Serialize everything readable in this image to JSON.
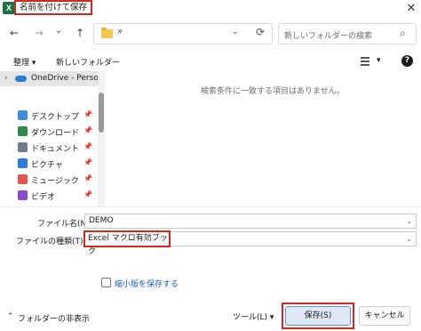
{
  "window": {
    "app_icon_letter": "X",
    "title": "名前を付けて保存",
    "close_glyph": "✕"
  },
  "address_bar": {
    "back_glyph": "←",
    "forward_glyph": "→",
    "history_glyph": "⌄",
    "up_glyph": "↑",
    "path_text": "»",
    "dropdown_glyph": "⌄",
    "refresh_glyph": "⟳"
  },
  "search": {
    "placeholder": "新しいフォルダーの検索",
    "icon": "search-icon",
    "icon_glyph": "⌕"
  },
  "toolbar": {
    "organize_label": "整理 ▾",
    "new_folder_label": "新しいフォルダー",
    "view_dropdown_glyph": "▾",
    "help_glyph": "?"
  },
  "nav_pane": {
    "items": [
      {
        "label": "OneDrive - Persor",
        "icon": "cloud-icon",
        "icon_color": "#2b7cd3",
        "pinned": false
      },
      {
        "label": "デスクトップ",
        "icon": "desktop-icon",
        "icon_color": "#3b8fd9",
        "pinned": true
      },
      {
        "label": "ダウンロード",
        "icon": "download-icon",
        "icon_color": "#2f8a4e",
        "pinned": true
      },
      {
        "label": "ドキュメント",
        "icon": "documents-icon",
        "icon_color": "#6f7b8a",
        "pinned": true
      },
      {
        "label": "ピクチャ",
        "icon": "pictures-icon",
        "icon_color": "#2f7ad9",
        "pinned": true
      },
      {
        "label": "ミュージック",
        "icon": "music-icon",
        "icon_color": "#e2554f",
        "pinned": true
      },
      {
        "label": "ビデオ",
        "icon": "videos-icon",
        "icon_color": "#8a4bd1",
        "pinned": true
      }
    ],
    "pin_glyph": "📌",
    "expand_glyph": "›"
  },
  "content": {
    "empty_message": "検索条件に一致する項目はありません。"
  },
  "form": {
    "filename_label": "ファイル名(N):",
    "filename_value": "DEMO",
    "filetype_label": "ファイルの種類(T):",
    "filetype_value": "Excel マクロ有効ブック",
    "dropdown_glyph": "⌄",
    "thumbnail_label": "縮小版を保存する"
  },
  "footer": {
    "hide_folders_label": "フォルダーの非表示",
    "hide_folders_glyph": "⌃",
    "tools_label": "ツール(L) ▾",
    "save_label": "保存(S)",
    "cancel_label": "キャンセル"
  },
  "colors": {
    "highlight_red": "#d7261e",
    "link_blue": "#1a5fb4",
    "excel_green": "#1d7044"
  }
}
